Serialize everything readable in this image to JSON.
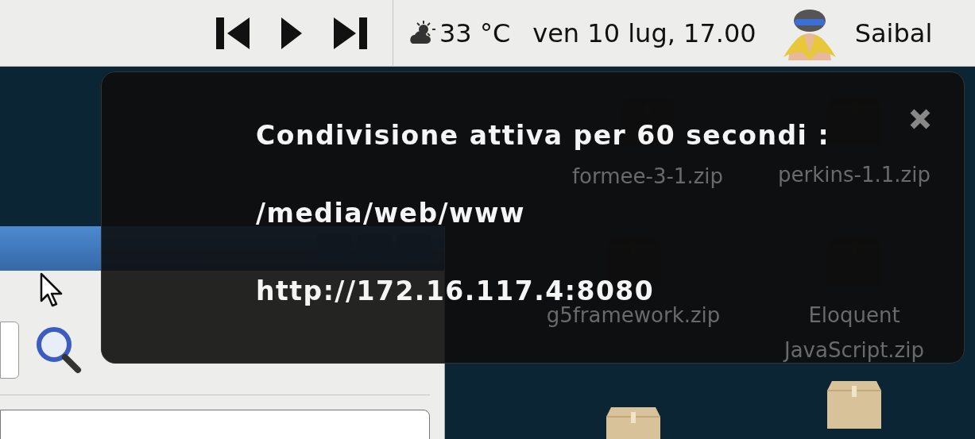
{
  "top_bar": {
    "temperature": "33 °C",
    "clock": "ven 10 lug, 17.00",
    "user": "Saibal"
  },
  "notification": {
    "lines": [
      "Condivisione attiva per 60 secondi :",
      "/media/web/www",
      "http://172.16.117.4:8080"
    ]
  },
  "desktop_icons": [
    {
      "label": "formee-3-1.zip"
    },
    {
      "label": "perkins-1.1.zip"
    },
    {
      "label": "g5framework.zip"
    },
    {
      "label": "Eloquent JavaScript.zip"
    }
  ]
}
